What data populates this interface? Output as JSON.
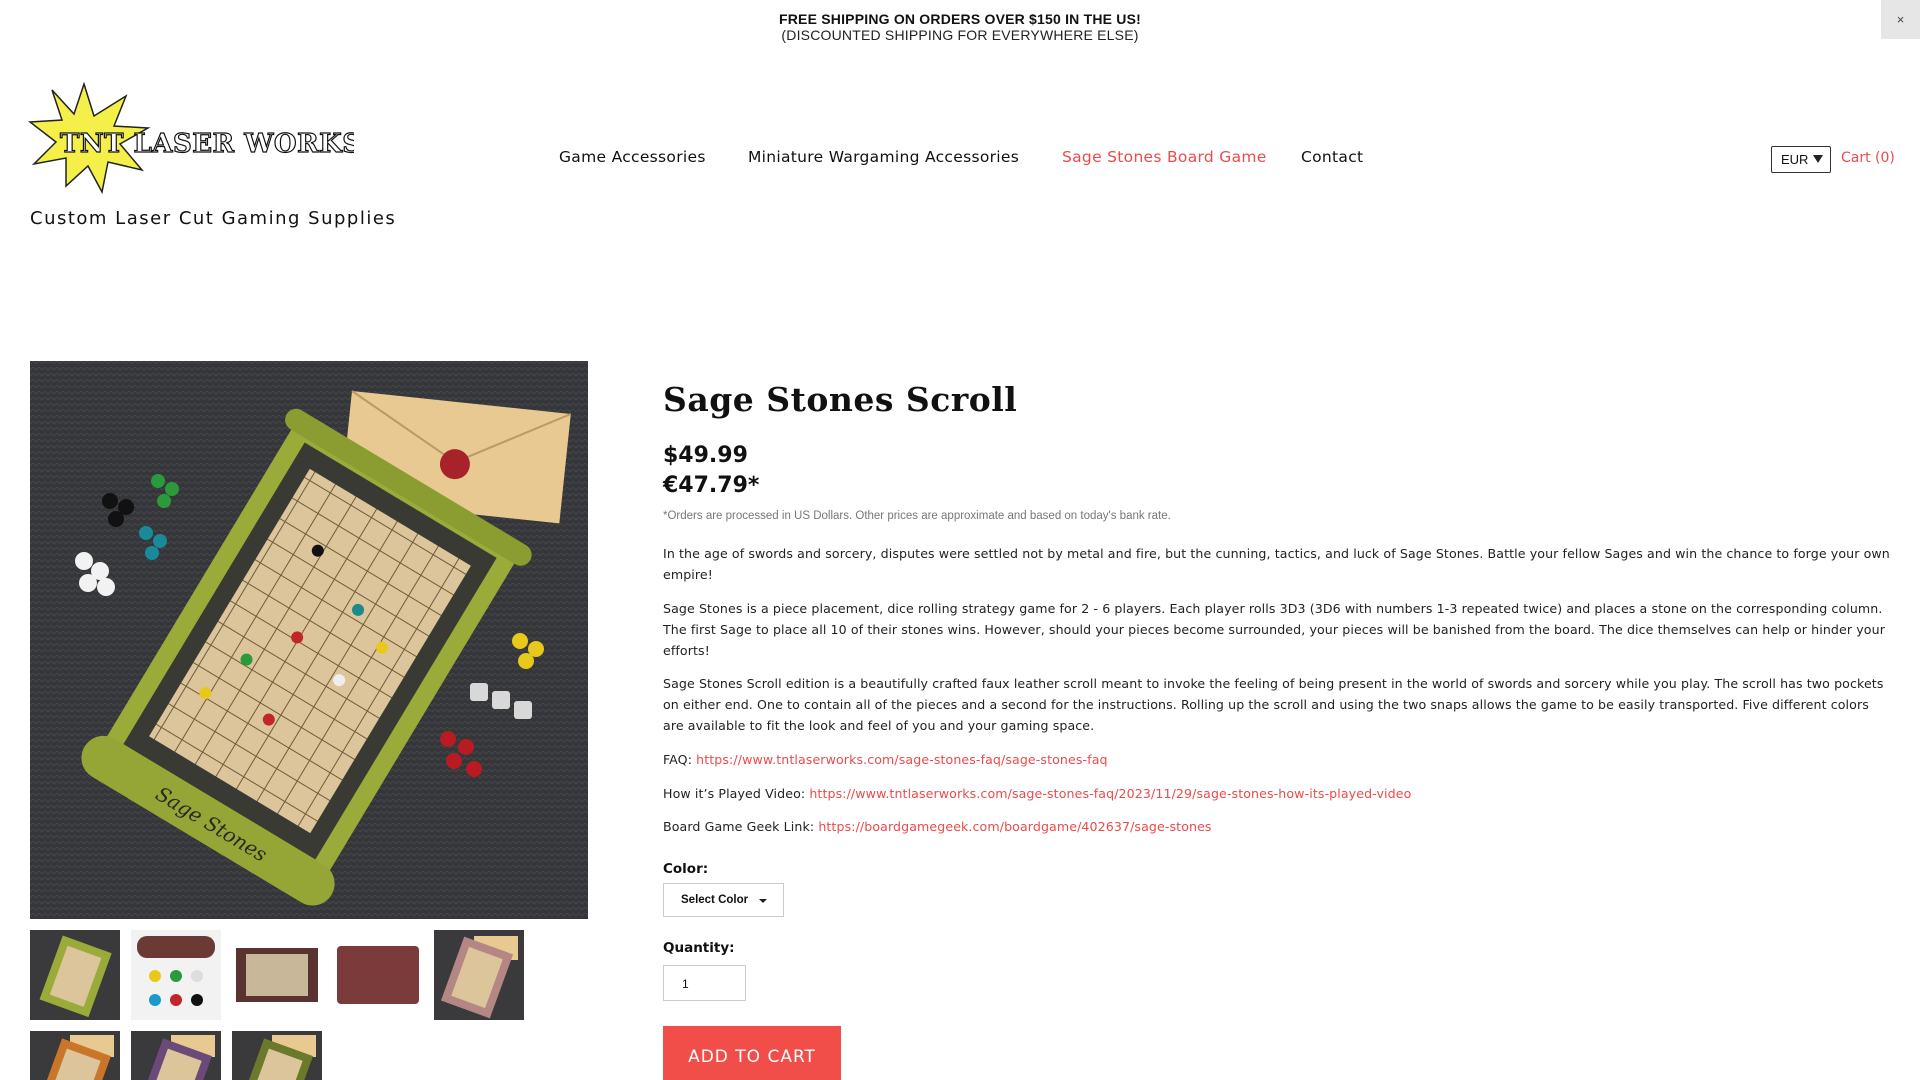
{
  "announcement": {
    "line1": "FREE SHIPPING ON ORDERS OVER $150 IN THE US!",
    "line2": "(DISCOUNTED SHIPPING FOR EVERYWHERE ELSE)",
    "close": "×"
  },
  "brand": {
    "logo_text": "TNT LASER WORKS LLC",
    "tagline": "Custom Laser Cut Gaming Supplies"
  },
  "nav": {
    "items": [
      {
        "label": "Game Accessories"
      },
      {
        "label": "Miniature Wargaming Accessories"
      },
      {
        "label": "Sage Stones Board Game",
        "active": true
      },
      {
        "label": "Contact"
      }
    ],
    "currency": "EUR",
    "cart": "Cart (0)"
  },
  "product": {
    "title": "Sage Stones Scroll",
    "price_usd": "$49.99",
    "price_eur": "€47.79*",
    "disclaimer": "*Orders are processed in US Dollars. Other prices are approximate and based on today's bank rate.",
    "description": [
      "In the age of swords and sorcery, disputes were settled not by metal and fire, but the cunning, tactics, and luck of Sage Stones. Battle your fellow Sages and win the chance to forge your own empire!",
      "Sage Stones is a piece placement, dice rolling strategy game for 2 - 6 players. Each player rolls 3D3 (3D6 with numbers 1-3 repeated twice) and places a stone on the corresponding column. The first Sage to place all 10 of their stones wins. However, should your pieces become surrounded, your pieces will be banished from the board. The dice themselves can help or hinder your efforts!",
      "Sage Stones Scroll edition is a beautifully crafted faux leather scroll meant to invoke the feeling of being present in the world of swords and sorcery while you play. The scroll has two pockets on either end. One to contain all of the pieces and a second for the instructions. Rolling up the scroll and using the two snaps allows the game to be easily transported. Five different colors are available to fit the look and feel of you and your gaming space."
    ],
    "links": {
      "faq_label": "FAQ: ",
      "faq_url": "https://www.tntlaserworks.com/sage-stones-faq/sage-stones-faq",
      "video_label": "How it’s Played Video: ",
      "video_url": "https://www.tntlaserworks.com/sage-stones-faq/2023/11/29/sage-stones-how-its-played-video",
      "bgg_label": "Board Game Geek Link: ",
      "bgg_url": "https://boardgamegeek.com/boardgame/402637/sage-stones"
    },
    "color_label": "Color:",
    "color_select": "Select Color",
    "quantity_label": "Quantity:",
    "quantity_value": "1",
    "add_to_cart": "ADD TO CART",
    "image_text": "Sage Stones",
    "thumbnail_count": 8
  },
  "colors": {
    "accent": "#ed4a4a",
    "button": "#f14d49"
  }
}
